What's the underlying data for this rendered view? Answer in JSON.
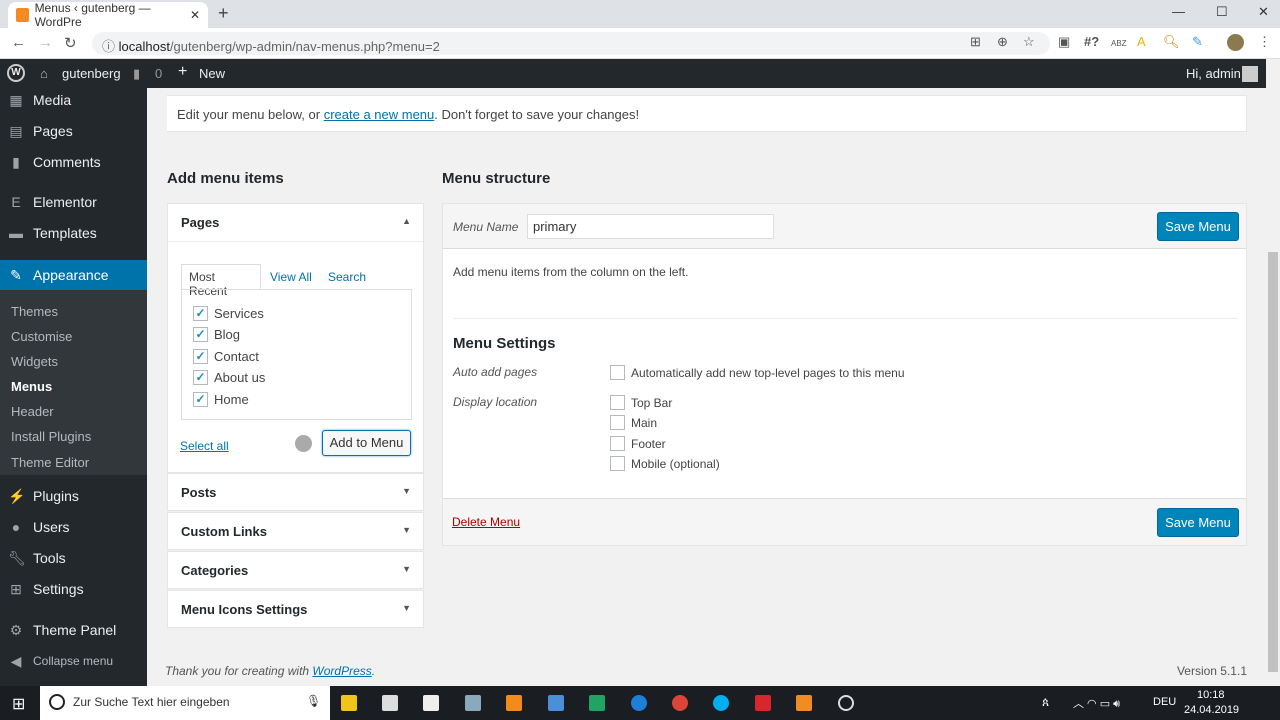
{
  "browser": {
    "tab_title": "Menus ‹ gutenberg — WordPre",
    "url_host": "localhost",
    "url_path": "/gutenberg/wp-admin/nav-menus.php?menu=2",
    "ext_hash": "#?",
    "ext_abz": "ABZ"
  },
  "adminbar": {
    "site": "gutenberg",
    "comments": "0",
    "new": "New",
    "greeting": "Hi, admin"
  },
  "sidebar": {
    "items": [
      "Media",
      "Pages",
      "Comments",
      "Elementor",
      "Templates",
      "Appearance",
      "Plugins",
      "Users",
      "Tools",
      "Settings",
      "Theme Panel",
      "Collapse menu"
    ],
    "submenu": [
      "Themes",
      "Customise",
      "Widgets",
      "Menus",
      "Header",
      "Install Plugins",
      "Theme Editor"
    ]
  },
  "notice": {
    "before": "Edit your menu below, or ",
    "link": "create a new menu",
    "after": ". Don't forget to save your changes!"
  },
  "left": {
    "title": "Add menu items",
    "pages": "Pages",
    "tabs": [
      "Most Recent",
      "View All",
      "Search"
    ],
    "page_items": [
      "Services",
      "Blog",
      "Contact",
      "About us",
      "Home"
    ],
    "select_all": "Select all",
    "add_button": "Add to Menu",
    "sections": [
      "Posts",
      "Custom Links",
      "Categories",
      "Menu Icons Settings"
    ]
  },
  "right": {
    "title": "Menu structure",
    "menu_name_label": "Menu Name",
    "menu_name": "primary",
    "save": "Save Menu",
    "hint": "Add menu items from the column on the left.",
    "settings_title": "Menu Settings",
    "auto_label": "Auto add pages",
    "auto_option": "Automatically add new top-level pages to this menu",
    "display_label": "Display location",
    "locations": [
      "Top Bar",
      "Main",
      "Footer",
      "Mobile (optional)"
    ],
    "delete": "Delete Menu"
  },
  "footer": {
    "thanks": "Thank you for creating with ",
    "wp": "WordPress",
    "period": ".",
    "version": "Version 5.1.1"
  },
  "taskbar": {
    "search": "Zur Suche Text hier eingeben",
    "lang": "DEU",
    "time": "10:18",
    "date": "24.04.2019"
  }
}
